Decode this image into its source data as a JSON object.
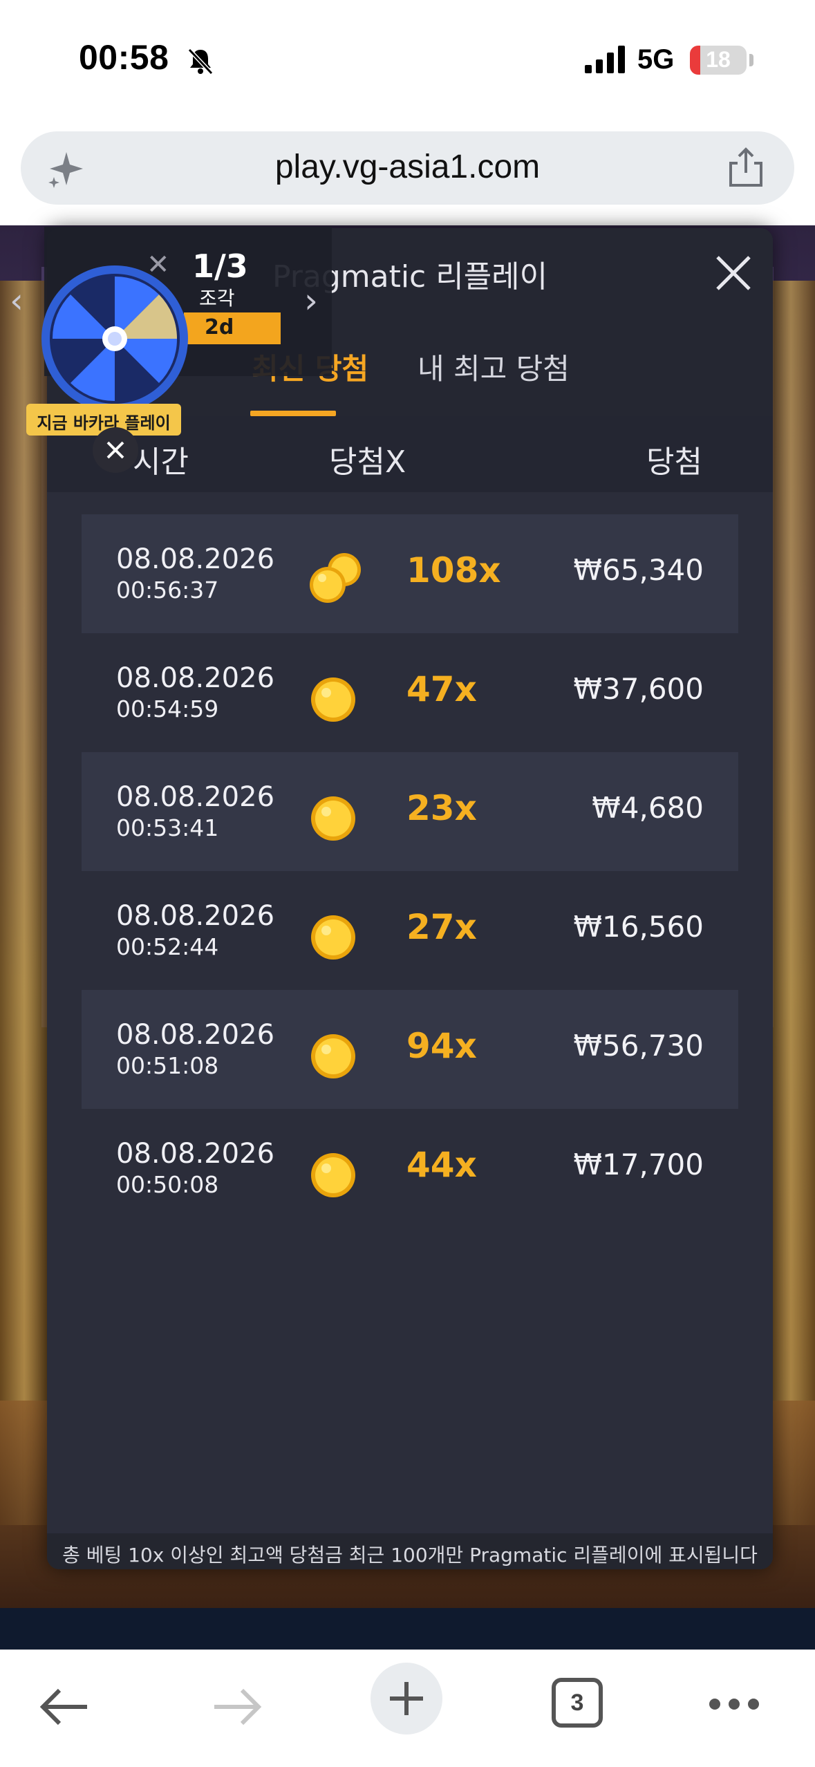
{
  "status_bar": {
    "time": "00:58",
    "network": "5G",
    "battery_level": "18",
    "battery_fraction": 0.18
  },
  "browser": {
    "url": "play.vg-asia1.com",
    "tab_count": "3"
  },
  "widget": {
    "piece_count": "1/3",
    "piece_label": "조각",
    "badge": "2d",
    "wheel_label": "지금 바카라 플레이"
  },
  "modal": {
    "title": "Pragmatic 리플레이",
    "tabs": [
      {
        "label": "최신 당첨",
        "active": true
      },
      {
        "label": "내 최고 당첨",
        "active": false
      }
    ],
    "columns": {
      "time": "시간",
      "multiplier": "당첨X",
      "win": "당첨"
    },
    "rows": [
      {
        "date": "08.08.2026",
        "time": "00:56:37",
        "multiplier": "108x",
        "win": "₩65,340",
        "coins": 2
      },
      {
        "date": "08.08.2026",
        "time": "00:54:59",
        "multiplier": "47x",
        "win": "₩37,600",
        "coins": 1
      },
      {
        "date": "08.08.2026",
        "time": "00:53:41",
        "multiplier": "23x",
        "win": "₩4,680",
        "coins": 1
      },
      {
        "date": "08.08.2026",
        "time": "00:52:44",
        "multiplier": "27x",
        "win": "₩16,560",
        "coins": 1
      },
      {
        "date": "08.08.2026",
        "time": "00:51:08",
        "multiplier": "94x",
        "win": "₩56,730",
        "coins": 1
      },
      {
        "date": "08.08.2026",
        "time": "00:50:08",
        "multiplier": "44x",
        "win": "₩17,700",
        "coins": 1
      }
    ],
    "footer_note": "총 베팅 10x 이상인 최고액 당첨금 최근 100개만 Pragmatic 리플레이에 표시됩니다"
  },
  "colors": {
    "accent": "#f5a623",
    "modal_bg": "#2b2d3a",
    "row_alt": "#343747",
    "multiplier": "#f5b021"
  },
  "icons": {
    "bell": "bell-slash-icon",
    "signal": "signal-icon",
    "sparkle": "sparkle-icon",
    "share": "share-icon",
    "close": "close-icon",
    "coin": "coin-icon",
    "wheel": "wheel-icon",
    "back": "back-arrow-icon",
    "forward": "forward-arrow-icon",
    "plus": "plus-icon",
    "more": "more-icon"
  }
}
